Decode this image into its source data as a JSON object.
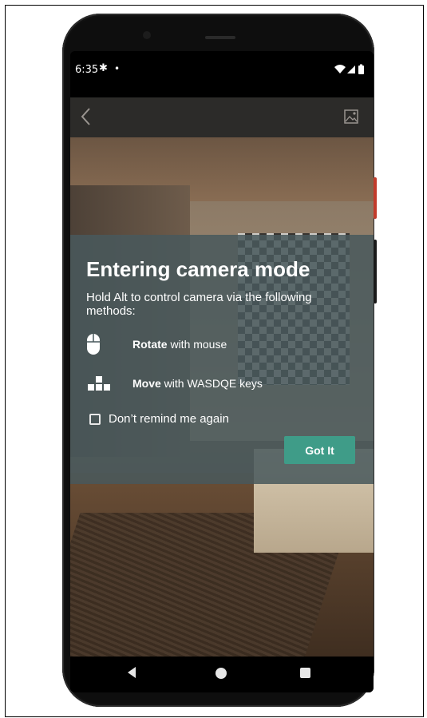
{
  "status_bar": {
    "time": "6:35",
    "gear_icon": "settings-gear-icon",
    "dot": "•",
    "icons": [
      "wifi-icon",
      "signal-icon",
      "battery-icon"
    ]
  },
  "header": {
    "back_icon": "chevron-left-icon",
    "gallery_icon": "image-gallery-icon"
  },
  "dialog": {
    "title": "Entering camera mode",
    "body": "Hold Alt to control camera via the following methods:",
    "methods": [
      {
        "icon": "mouse-icon",
        "bold": "Rotate",
        "rest": " with mouse"
      },
      {
        "icon": "keys-icon",
        "bold": "Move",
        "rest": " with WASDQE keys"
      }
    ],
    "remind_label": "Don’t remind me again",
    "remind_checked": false,
    "button_label": "Got It",
    "button_color": "#3f9c88",
    "panel_color": "#48585c"
  },
  "nav": {
    "back": "triangle-back-icon",
    "home": "circle-home-icon",
    "recents": "square-recents-icon"
  }
}
